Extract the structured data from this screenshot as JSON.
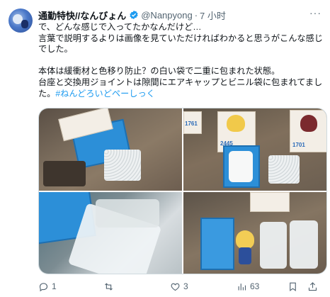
{
  "tweet": {
    "display_name": "通勤特快//なんびょん",
    "handle": "@Nanpyong",
    "separator": "·",
    "time": "7 小时",
    "text": "で、どんな感じで入ってたかなんだけど…\n言葉で説明するよりは画像を見ていただければわかると思うがこんな感じでした。\n\n本体は緩衝材と色移り防止？の白い袋で二重に包まれた状態。\n台座と交換用ジョイントは隙間にエアキャップとビニル袋に包まれてました。",
    "hashtag": "#ねんどろいどペーしっく",
    "more": "···"
  },
  "media": {
    "photos": [
      {
        "label": "photo-1",
        "package_number": ""
      },
      {
        "label": "photo-2",
        "package_number": "1761"
      },
      {
        "label": "photo-3",
        "package_number": ""
      },
      {
        "label": "photo-4",
        "package_number": ""
      }
    ],
    "package_numbers": {
      "a": "1761",
      "b": "2445",
      "c": "1701"
    }
  },
  "actions": {
    "reply_count": "1",
    "retweet_count": "",
    "like_count": "3",
    "view_count": "63"
  },
  "icons": {
    "verified": "verified-badge-icon",
    "reply": "reply-icon",
    "retweet": "retweet-icon",
    "like": "heart-icon",
    "views": "views-icon",
    "bookmark": "bookmark-icon",
    "share": "share-icon",
    "more": "more-icon"
  },
  "colors": {
    "link": "#1d9bf0",
    "verified": "#1d9bf0",
    "muted": "#536471"
  }
}
